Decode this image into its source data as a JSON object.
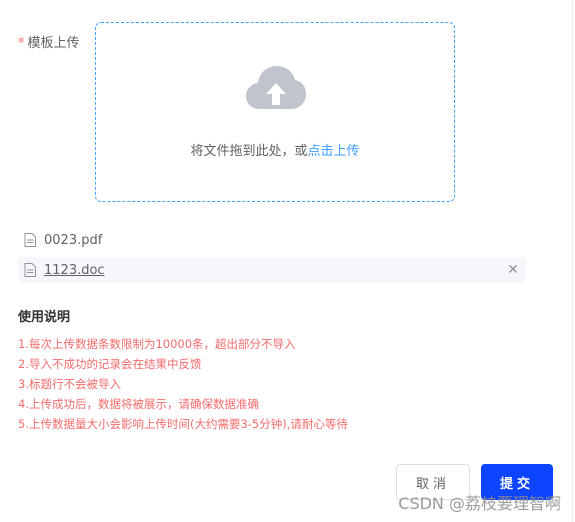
{
  "form": {
    "required_mark": "*",
    "label": "模板上传"
  },
  "upload": {
    "icon": "cloud-upload-icon",
    "text_prefix": "将文件拖到此处，或",
    "link_text": "点击上传",
    "accent": "#409eff"
  },
  "files": [
    {
      "name": "0023.pdf",
      "icon": "document-icon"
    },
    {
      "name": "1123.doc",
      "icon": "document-icon",
      "close": "✕"
    }
  ],
  "usage": {
    "title": "使用说明",
    "items": [
      "1.每次上传数据条数限制为10000条，超出部分不导入",
      "2.导入不成功的记录会在结果中反馈",
      "3.标题行不会被导入",
      "4.上传成功后，数据将被展示，请确保数据准确",
      "5.上传数据量大小会影响上传时间(大约需要3-5分钟),请耐心等待"
    ],
    "color": "#f56c6c"
  },
  "buttons": {
    "cancel": "取消",
    "submit": "提交",
    "submit_color": "#0c44ff"
  },
  "watermark": "CSDN @荔枝要理智啊"
}
